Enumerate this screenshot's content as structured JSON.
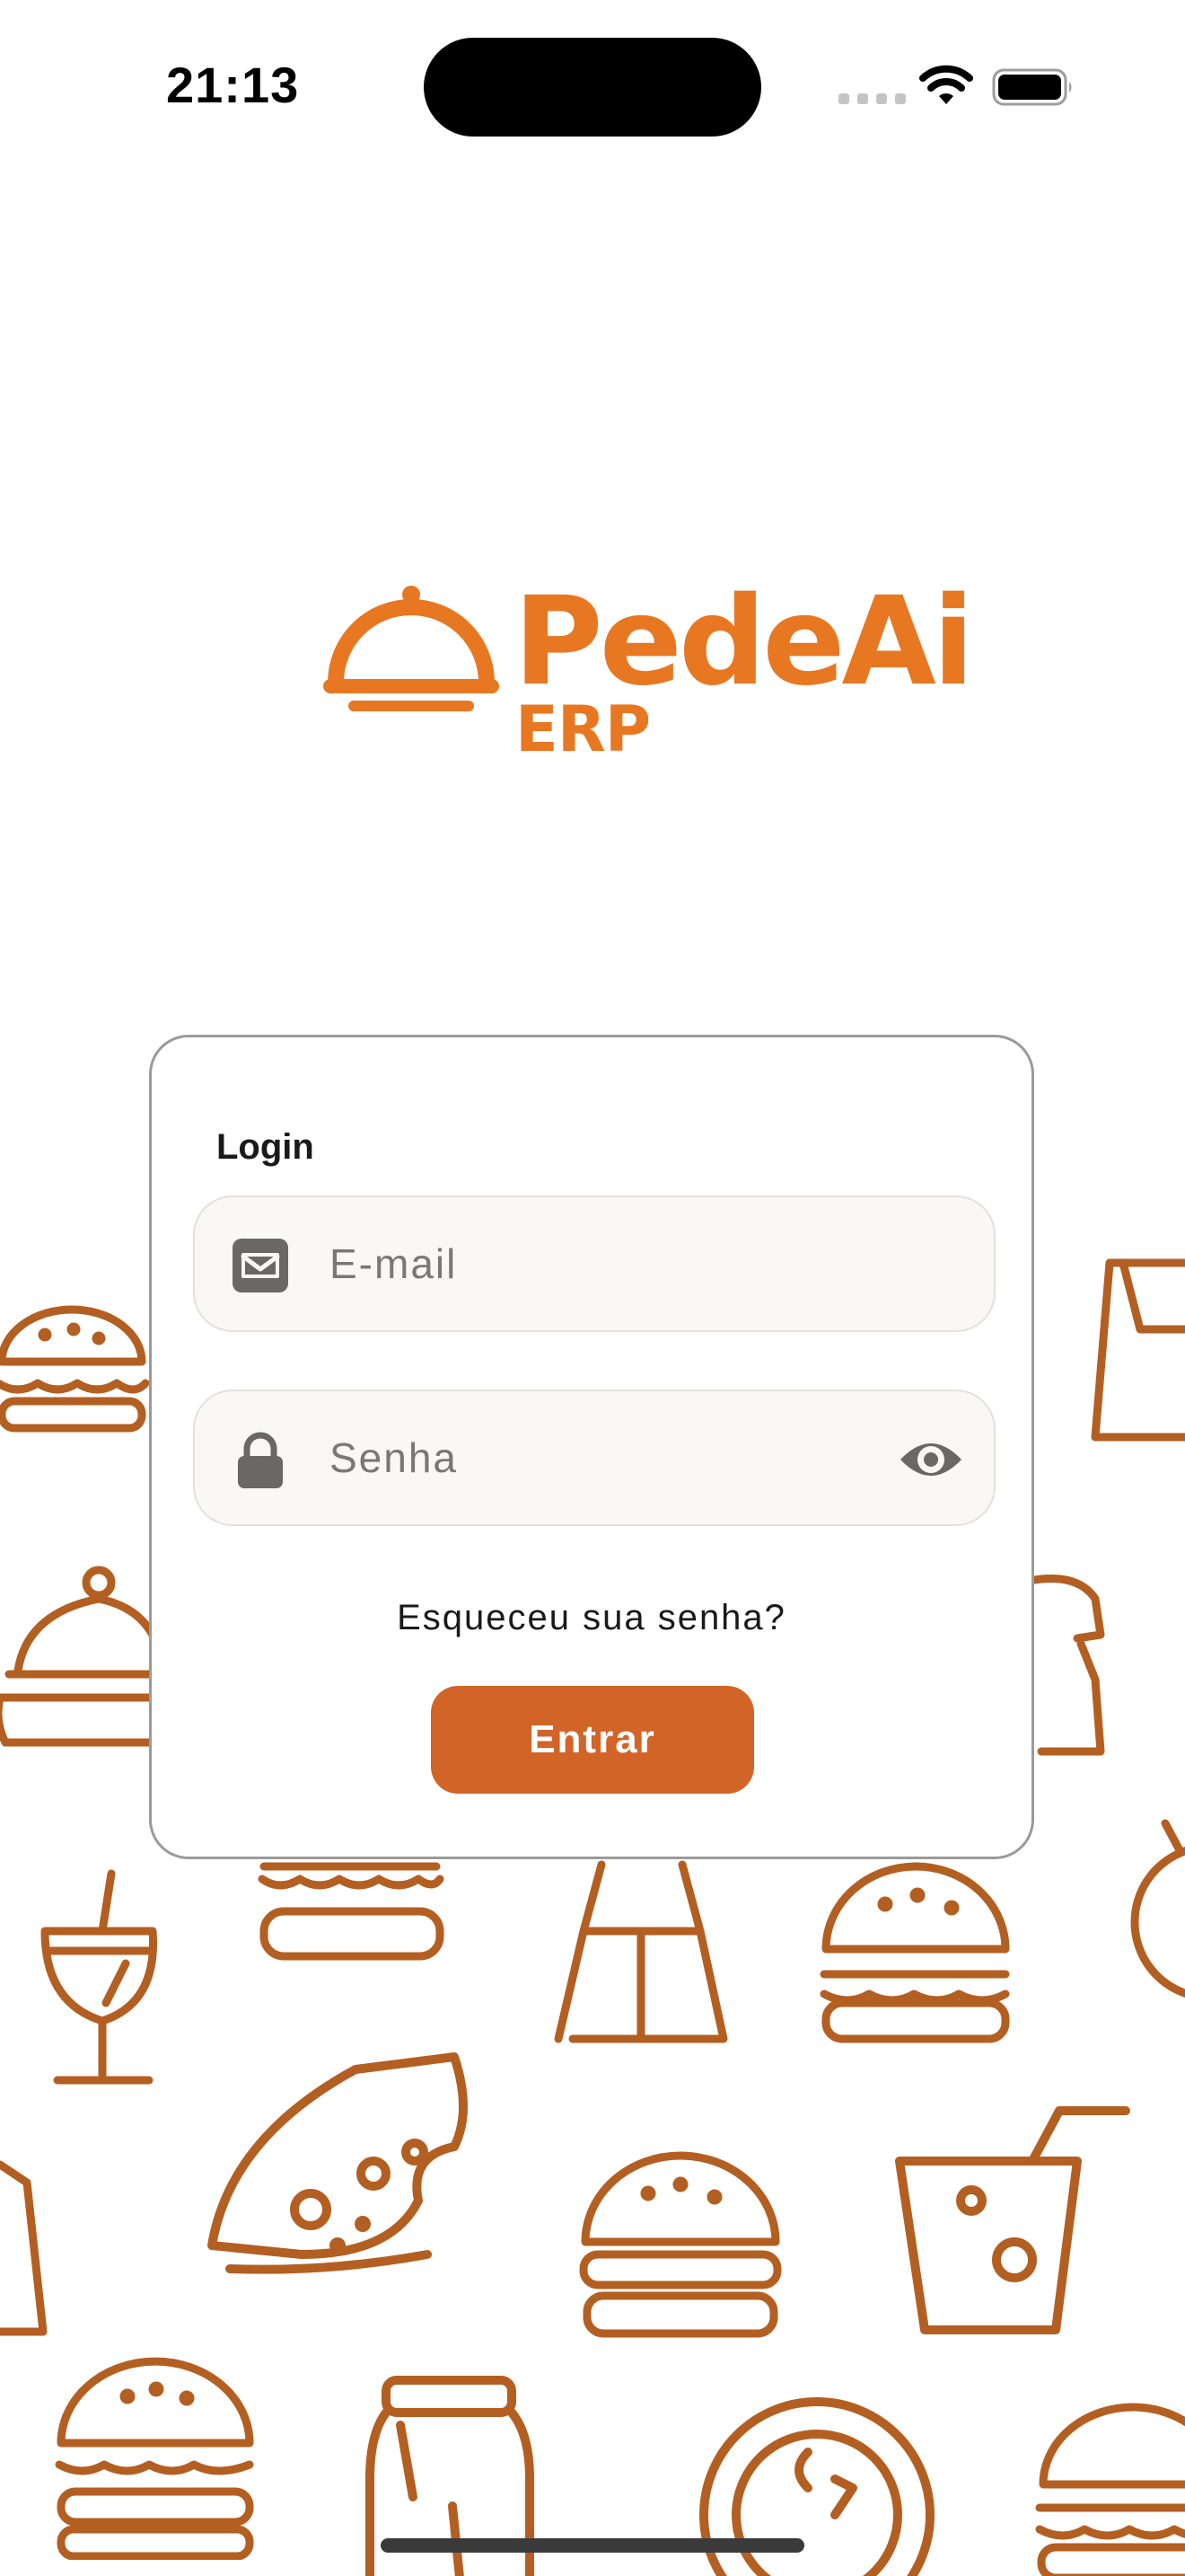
{
  "status_bar": {
    "time": "21:13"
  },
  "brand": {
    "name": "PedeAi",
    "suffix": "ERP",
    "color": "#e87722",
    "logo_icon": "food-cloche-icon"
  },
  "login_form": {
    "title": "Login",
    "email": {
      "placeholder": "E-mail",
      "value": "",
      "icon": "envelope-icon"
    },
    "password": {
      "placeholder": "Senha",
      "value": "",
      "icon": "lock-icon",
      "toggle_icon": "eye-icon"
    },
    "forgot_password_label": "Esqueceu sua senha?",
    "submit_label": "Entrar"
  },
  "colors": {
    "accent": "#d26428",
    "pattern": "#b35f22",
    "card_border": "#9a9a9a",
    "field_background": "#faf8f6"
  },
  "background_pattern": {
    "icons": [
      "burger-icon",
      "food-bag-icon",
      "takeaway-cup-icon",
      "drink-glass-icon",
      "pizza-slice-icon",
      "soda-cup-icon",
      "pizza-icon",
      "cheese-icon"
    ]
  }
}
